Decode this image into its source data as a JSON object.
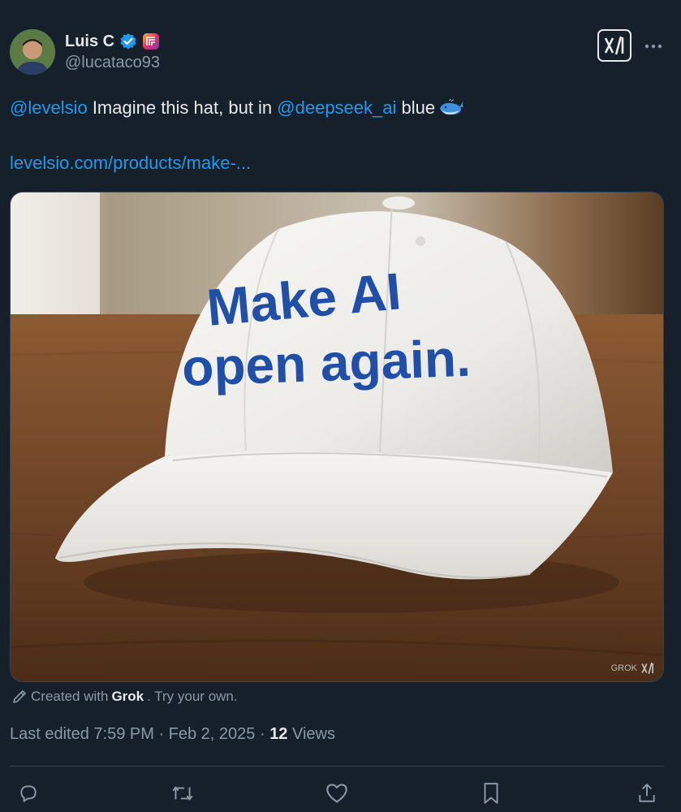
{
  "author": {
    "name": "Luis C",
    "handle": "@lucataco93",
    "verified": true,
    "verified_color": "#1d9bf0"
  },
  "tweet": {
    "mention1": "@levelsio",
    "text1": " Imagine this hat, but in ",
    "mention2": "@deepseek_ai",
    "text2": " blue",
    "emoji": "whale-icon",
    "link": "levelsio.com/products/make-..."
  },
  "media": {
    "hat_text_line1": "Make AI",
    "hat_text_line2": "open again.",
    "watermark": "GROK",
    "hat_text_color": "#1f4fa8"
  },
  "attribution": {
    "prefix": "Created with ",
    "brand": "Grok",
    "suffix": ".  Try your own."
  },
  "meta": {
    "edited": "Last edited 7:59 PM · Feb 2, 2025 · ",
    "views_count": "12",
    "views_label": " Views"
  },
  "actions": [
    "reply-icon",
    "retweet-icon",
    "like-icon",
    "bookmark-icon",
    "share-icon"
  ],
  "colors": {
    "background": "#15202b",
    "accent": "#1d9bf0",
    "muted": "#8b98a5"
  }
}
